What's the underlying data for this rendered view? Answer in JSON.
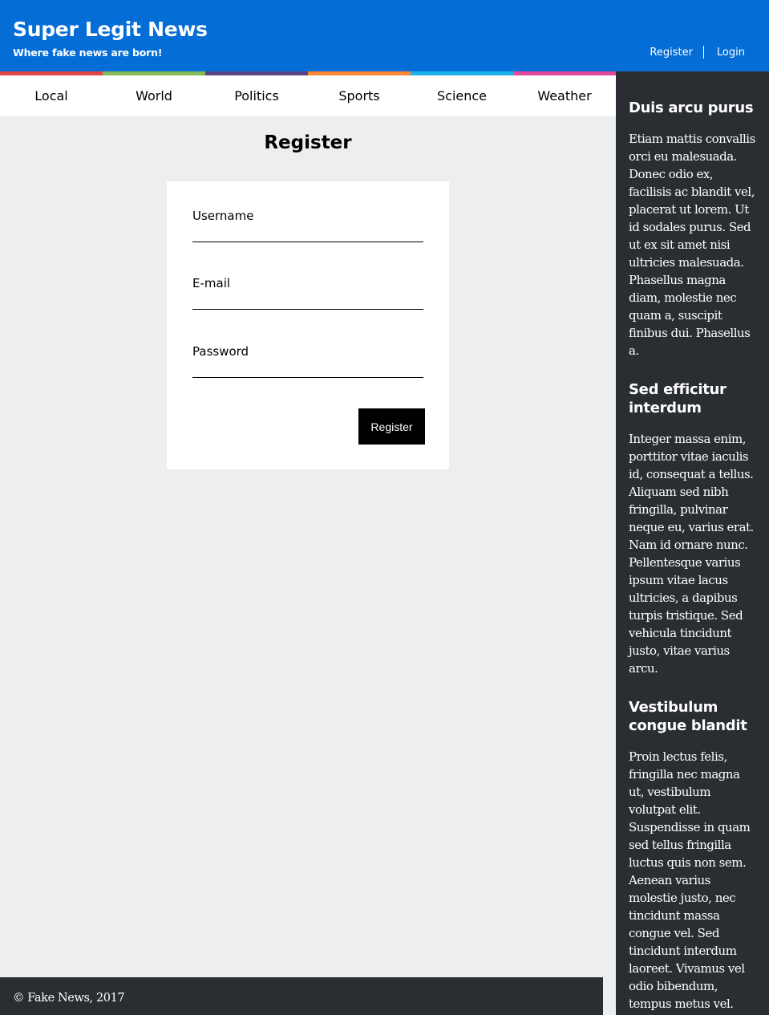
{
  "header": {
    "title": "Super Legit News",
    "tagline": "Where fake news are born!",
    "register_label": "Register",
    "login_label": "Login",
    "bg_color": "#056dd6"
  },
  "nav": {
    "items": [
      {
        "label": "Local",
        "color": "#e04646"
      },
      {
        "label": "World",
        "color": "#84bb57"
      },
      {
        "label": "Politics",
        "color": "#594586"
      },
      {
        "label": "Sports",
        "color": "#fd8833"
      },
      {
        "label": "Science",
        "color": "#19b2e8"
      },
      {
        "label": "Weather",
        "color": "#e3489a"
      }
    ]
  },
  "main": {
    "title": "Register",
    "form": {
      "username_label": "Username",
      "username_value": "",
      "email_label": "E-mail",
      "email_value": "",
      "password_label": "Password",
      "password_value": "",
      "submit_label": "Register"
    }
  },
  "sidebar": {
    "sections": [
      {
        "title": "Duis arcu purus",
        "body": "Etiam mattis convallis orci eu malesuada. Donec odio ex, facilisis ac blandit vel, placerat ut lorem. Ut id sodales purus. Sed ut ex sit amet nisi ultricies malesuada. Phasellus magna diam, molestie nec quam a, suscipit finibus dui. Phasellus a."
      },
      {
        "title": "Sed efficitur interdum",
        "body": "Integer massa enim, porttitor vitae iaculis id, consequat a tellus. Aliquam sed nibh fringilla, pulvinar neque eu, varius erat. Nam id ornare nunc. Pellentesque varius ipsum vitae lacus ultricies, a dapibus turpis tristique. Sed vehicula tincidunt justo, vitae varius arcu."
      },
      {
        "title": "Vestibulum congue blandit",
        "body": "Proin lectus felis, fringilla nec magna ut, vestibulum volutpat elit. Suspendisse in quam sed tellus fringilla luctus quis non sem. Aenean varius molestie justo, nec tincidunt massa congue vel. Sed tincidunt interdum laoreet. Vivamus vel odio bibendum, tempus metus vel."
      }
    ]
  },
  "footer": {
    "text": "© Fake News, 2017"
  }
}
